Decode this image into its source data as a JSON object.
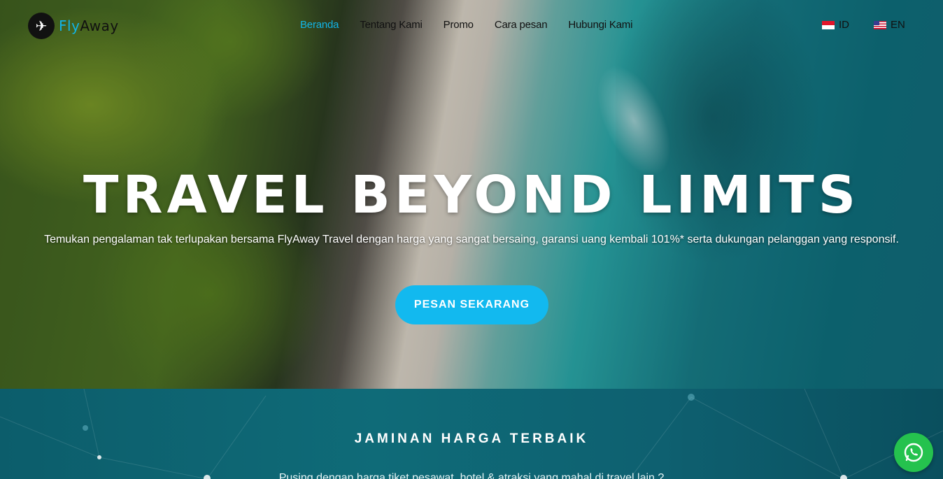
{
  "logo": {
    "text_fly": "Fly",
    "text_away": "Away",
    "icon": "airplane-icon"
  },
  "nav": {
    "items": [
      {
        "label": "Beranda",
        "active": true
      },
      {
        "label": "Tentang Kami",
        "active": false
      },
      {
        "label": "Promo",
        "active": false
      },
      {
        "label": "Cara pesan",
        "active": false
      },
      {
        "label": "Hubungi Kami",
        "active": false
      }
    ],
    "languages": [
      {
        "code": "ID",
        "flag": "indonesia-flag-icon"
      },
      {
        "code": "EN",
        "flag": "usa-flag-icon"
      }
    ]
  },
  "hero": {
    "headline": "TRAVEL BEYOND LIMITS",
    "subtext": "Temukan pengalaman tak terlupakan bersama FlyAway Travel dengan harga yang sangat bersaing, garansi uang kembali 101%* serta dukungan pelanggan yang responsif.",
    "cta_label": "PESAN SEKARANG"
  },
  "guarantee": {
    "title": "JAMINAN HARGA TERBAIK",
    "text": "Pusing dengan harga tiket pesawat, hotel & atraksi yang mahal di travel lain ?"
  },
  "whatsapp": {
    "icon": "whatsapp-icon"
  },
  "colors": {
    "accent": "#12b9ef",
    "whatsapp": "#25c24e",
    "section_bg": "#0e6574"
  }
}
